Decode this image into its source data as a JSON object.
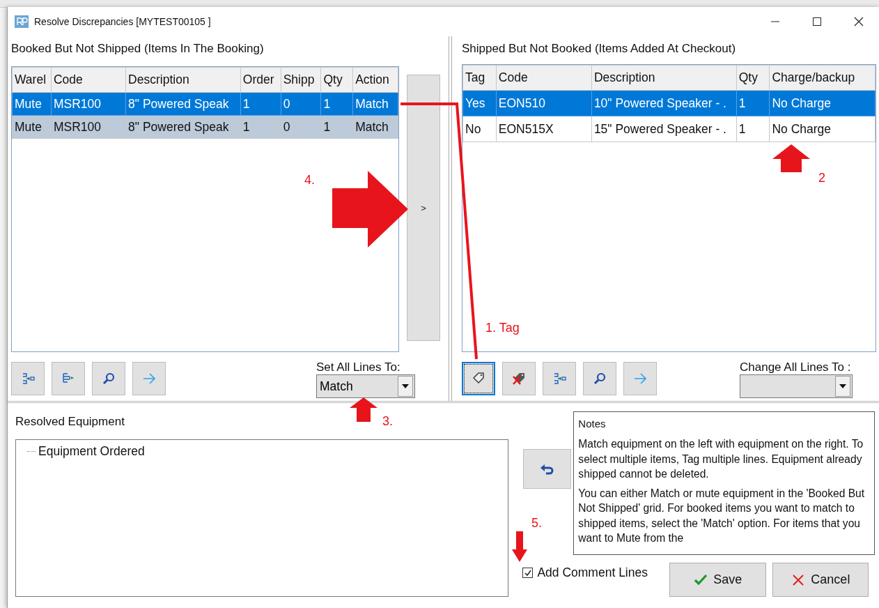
{
  "window": {
    "title": "Resolve Discrepancies [MYTEST00105  ]"
  },
  "booked": {
    "title": "Booked But Not Shipped (Items In The Booking)",
    "columns": [
      "Warel",
      "Code",
      "Description",
      "Order",
      "Shipp",
      "Qty",
      "Action"
    ],
    "rows": [
      {
        "cells": [
          "Mute",
          "MSR100",
          "8\" Powered Speak",
          "1",
          "0",
          "1",
          "Match"
        ],
        "selected": true
      },
      {
        "cells": [
          "Mute",
          "MSR100",
          "8\" Powered Speak",
          "1",
          "0",
          "1",
          "Match"
        ],
        "selected": false,
        "tagged": true
      }
    ],
    "toolbar": [
      {
        "kind": "collapse",
        "focused": false
      },
      {
        "kind": "expand",
        "focused": false
      },
      {
        "kind": "search",
        "focused": false
      },
      {
        "kind": "arrow",
        "focused": false
      }
    ],
    "set_all": {
      "label": "Set All Lines To:",
      "value": "Match"
    }
  },
  "move_button": {
    "label": ">"
  },
  "shipped": {
    "title": "Shipped But Not Booked (Items Added At Checkout)",
    "columns": [
      "Tag",
      "Code",
      "Description",
      "Qty",
      "Charge/backup"
    ],
    "rows": [
      {
        "cells": [
          "Yes",
          "EON510",
          "10\" Powered Speaker - .",
          "1",
          "No Charge"
        ],
        "selected": true
      },
      {
        "cells": [
          "No",
          "EON515X",
          "15\" Powered Speaker - .",
          "1",
          "No Charge"
        ],
        "selected": false,
        "tagged": false
      }
    ],
    "toolbar": [
      {
        "kind": "tag",
        "focused": true
      },
      {
        "kind": "untag",
        "focused": false
      },
      {
        "kind": "collapse",
        "focused": false
      },
      {
        "kind": "search",
        "focused": false
      },
      {
        "kind": "arrow",
        "focused": false
      }
    ],
    "change_all": {
      "label": "Change All Lines To :"
    }
  },
  "resolved": {
    "title": "Resolved Equipment",
    "tree": [
      {
        "label": "Equipment Ordered"
      }
    ]
  },
  "notes": {
    "title": "Notes",
    "paragraphs": [
      "Match equipment on the left with equipment on the right. To select multiple items, Tag multiple lines. Equipment already shipped cannot be deleted.",
      "You can either Match or mute equipment in the 'Booked But Not Shipped' grid. For booked items you want to match to shipped items, select the 'Match' option. For items that you want to Mute from the"
    ]
  },
  "add_comment": {
    "label": "Add Comment Lines",
    "checked": true
  },
  "buttons": [
    {
      "kind": "save",
      "label": "Save"
    },
    {
      "kind": "cancel",
      "label": "Cancel"
    }
  ],
  "annotations": [
    {
      "text": "4."
    },
    {
      "text": "1. Tag"
    },
    {
      "text": "2"
    },
    {
      "text": "3."
    },
    {
      "text": "5."
    }
  ]
}
